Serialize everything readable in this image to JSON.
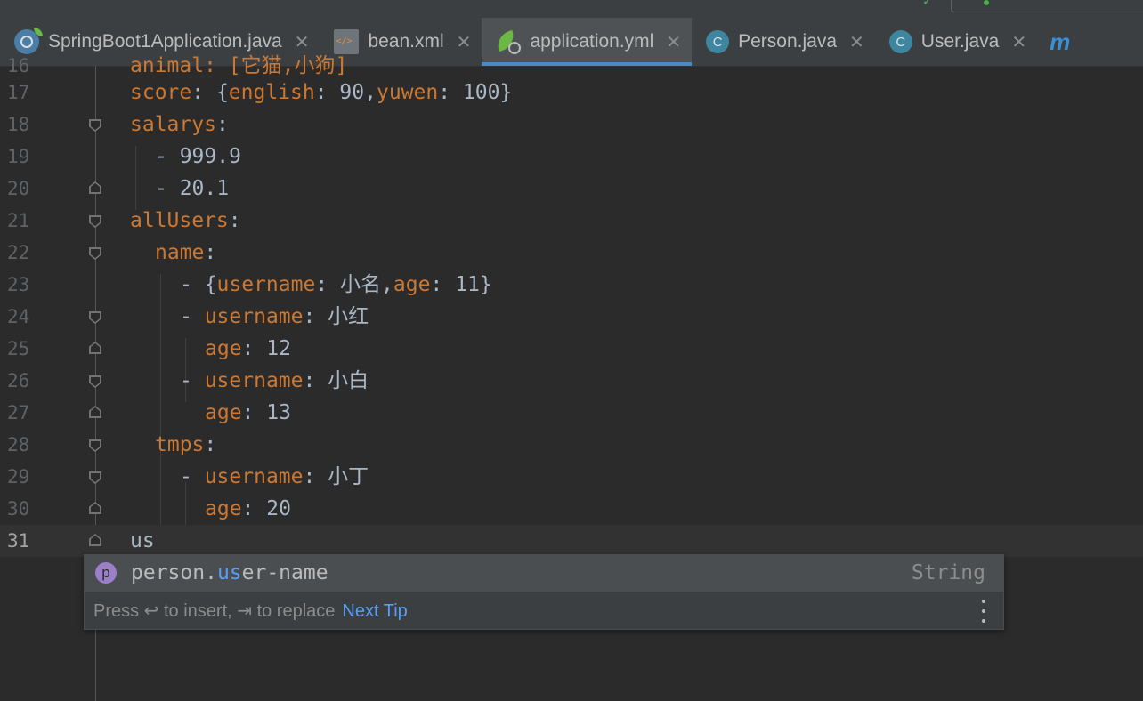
{
  "tabs": [
    {
      "label": "SpringBoot1Application.java",
      "icon": "spring-boot-icon",
      "active": false
    },
    {
      "label": "bean.xml",
      "icon": "xml-file-icon",
      "active": false
    },
    {
      "label": "application.yml",
      "icon": "spring-yaml-icon",
      "active": true
    },
    {
      "label": "Person.java",
      "icon": "class-icon",
      "icon_letter": "C",
      "active": false
    },
    {
      "label": "User.java",
      "icon": "class-icon",
      "icon_letter": "C",
      "active": false
    }
  ],
  "tab_close_glyph": "✕",
  "tab_overflow": "m",
  "editor": {
    "partial_line_number": "16",
    "partial_line_text": "animal: [它猫,小狗]",
    "lines": [
      {
        "num": "17",
        "key": "score",
        "rest": ": {",
        "k2": "english",
        "v2": ": 90,",
        "k3": "yuwen",
        "v3": ": 100}"
      },
      {
        "num": "18",
        "key": "salarys",
        "rest": ":"
      },
      {
        "num": "19",
        "text": "- 999.9"
      },
      {
        "num": "20",
        "text": "- 20.1"
      },
      {
        "num": "21",
        "key": "allUsers",
        "rest": ":"
      },
      {
        "num": "22",
        "key": "name",
        "rest": ":"
      },
      {
        "num": "23",
        "prefix": "- {",
        "key": "username",
        "rest": ": 小名,",
        "k2": "age",
        "v2": ": 11}"
      },
      {
        "num": "24",
        "prefix": "- ",
        "key": "username",
        "rest": ": 小红"
      },
      {
        "num": "25",
        "key": "age",
        "rest": ": 12"
      },
      {
        "num": "26",
        "prefix": "- ",
        "key": "username",
        "rest": ": 小白"
      },
      {
        "num": "27",
        "key": "age",
        "rest": ": 13"
      },
      {
        "num": "28",
        "key": "tmps",
        "rest": ":"
      },
      {
        "num": "29",
        "prefix": "- ",
        "key": "username",
        "rest": ": 小丁"
      },
      {
        "num": "30",
        "key": "age",
        "rest": ": 20"
      },
      {
        "num": "31",
        "text": "us"
      }
    ]
  },
  "completion": {
    "badge": "p",
    "item_prefix": "person.",
    "item_match": "us",
    "item_suffix": "er-name",
    "item_type": "String",
    "hint_text": "Press ↩ to insert, ⇥ to replace",
    "next_tip": "Next Tip"
  },
  "colors": {
    "background": "#2b2b2b",
    "key": "#cc7832",
    "text": "#a9b7c6",
    "accent": "#4a88c7",
    "match": "#589df6"
  }
}
